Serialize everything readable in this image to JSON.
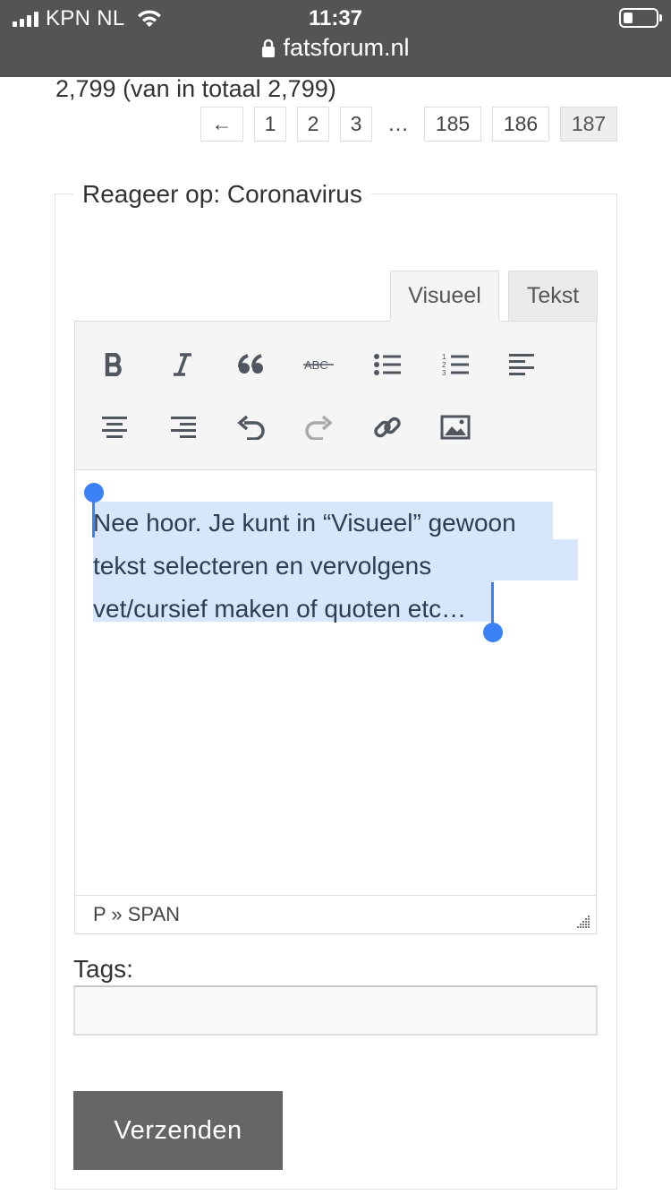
{
  "status_bar": {
    "carrier": "KPN NL",
    "time": "11:37",
    "url": "fatsforum.nl"
  },
  "topic": {
    "summary": "2,799 (van in totaal 2,799)"
  },
  "pagination": {
    "prev": "←",
    "pages": [
      "1",
      "2",
      "3",
      "185",
      "186",
      "187"
    ],
    "ellipsis": "…",
    "current": "187"
  },
  "reply": {
    "legend": "Reageer op: Coronavirus",
    "tabs": {
      "visual": "Visueel",
      "text": "Tekst"
    },
    "editor_lines": [
      "Nee hoor. Je kunt in “Visueel” gewoon",
      "tekst selecteren en vervolgens",
      "vet/cursief maken of quoten etc…"
    ],
    "path": "P » SPAN",
    "tags_label": "Tags:",
    "tags_value": "",
    "submit": "Verzenden"
  },
  "toolbar_icons": [
    "bold-icon",
    "italic-icon",
    "blockquote-icon",
    "strikethrough-icon",
    "bullet-list-icon",
    "numbered-list-icon",
    "align-left-icon",
    "align-center-icon",
    "align-right-icon",
    "undo-icon",
    "redo-icon",
    "link-icon",
    "image-icon"
  ],
  "colors": {
    "status_bar_bg": "#545454",
    "selection": "#d7e6fb",
    "selection_handle": "#3b82f6",
    "submit_bg": "#666666"
  }
}
